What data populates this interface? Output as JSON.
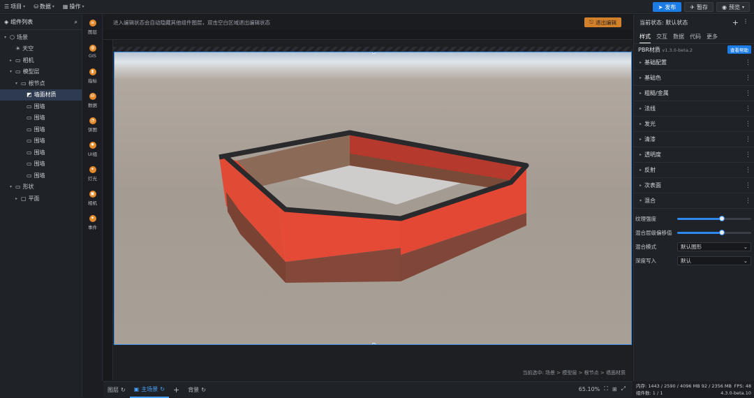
{
  "topbar": {
    "menus": [
      {
        "icon": "list-icon",
        "label": "项目"
      },
      {
        "icon": "database-icon",
        "label": "数据"
      },
      {
        "icon": "grid-icon",
        "label": "操作"
      }
    ],
    "publish_label": "发布",
    "save_label": "暂存",
    "preview_label": "预览"
  },
  "left": {
    "title": "组件列表",
    "tree": [
      {
        "label": "场景",
        "depth": 0,
        "caret": "down",
        "icon": "box-icon"
      },
      {
        "label": "天空",
        "depth": 1,
        "caret": "",
        "icon": "sun-icon"
      },
      {
        "label": "相机",
        "depth": 1,
        "caret": "right",
        "icon": "folder-icon"
      },
      {
        "label": "模型层",
        "depth": 1,
        "caret": "down",
        "icon": "folder-icon"
      },
      {
        "label": "根节点",
        "depth": 2,
        "caret": "down",
        "icon": "folder-icon"
      },
      {
        "label": "墙面材质",
        "depth": 3,
        "caret": "",
        "icon": "material-icon",
        "selected": true
      },
      {
        "label": "围墙",
        "depth": 3,
        "caret": "",
        "icon": "folder-icon"
      },
      {
        "label": "围墙",
        "depth": 3,
        "caret": "",
        "icon": "folder-icon"
      },
      {
        "label": "围墙",
        "depth": 3,
        "caret": "",
        "icon": "folder-icon"
      },
      {
        "label": "围墙",
        "depth": 3,
        "caret": "",
        "icon": "folder-icon"
      },
      {
        "label": "围墙",
        "depth": 3,
        "caret": "",
        "icon": "folder-icon"
      },
      {
        "label": "围墙",
        "depth": 3,
        "caret": "",
        "icon": "folder-icon"
      },
      {
        "label": "围墙",
        "depth": 3,
        "caret": "",
        "icon": "folder-icon"
      },
      {
        "label": "形状",
        "depth": 1,
        "caret": "down",
        "icon": "folder-icon"
      },
      {
        "label": "平面",
        "depth": 2,
        "caret": "right",
        "icon": "square-icon"
      }
    ]
  },
  "tools": [
    {
      "icon": "layers-icon",
      "label": "图层"
    },
    {
      "icon": "globe-icon",
      "label": "GIS"
    },
    {
      "icon": "chart-icon",
      "label": "指标"
    },
    {
      "icon": "database-icon",
      "label": "数据"
    },
    {
      "icon": "pie-icon",
      "label": "饼图"
    },
    {
      "icon": "gear-icon",
      "label": "UI组"
    },
    {
      "icon": "bulb-icon",
      "label": "灯光"
    },
    {
      "icon": "camera-icon",
      "label": "相机"
    },
    {
      "icon": "flame-icon",
      "label": "事件"
    }
  ],
  "canvas": {
    "hint": "进入编辑状态会自动隐藏其他组件图层，双击空白区域退出编辑状态",
    "exit_label": "退出编辑",
    "breadcrumb": "当前选中: 场景 > 模型层 > 根节点 > 墙面材质"
  },
  "bottom": {
    "tabs": [
      {
        "label": "图层",
        "active": false
      },
      {
        "label": "主场景",
        "active": true
      },
      {
        "label": "背景",
        "active": false
      }
    ],
    "add_label": "+",
    "zoom": "65.10%"
  },
  "right": {
    "state_label": "当前状态: 默认状态",
    "add_label": "+",
    "tabs": [
      "样式",
      "交互",
      "数据",
      "代码",
      "更多"
    ],
    "active_tab": 0,
    "material_name": "PBR材质",
    "material_version": "v1.3.0-beta.2",
    "view_button": "查看帮助",
    "sections": [
      {
        "label": "基础配置",
        "open": false
      },
      {
        "label": "基础色",
        "open": false
      },
      {
        "label": "粗糙/金属",
        "open": false
      },
      {
        "label": "法线",
        "open": false
      },
      {
        "label": "发光",
        "open": false
      },
      {
        "label": "清漆",
        "open": false
      },
      {
        "label": "透明度",
        "open": false
      },
      {
        "label": "反射",
        "open": false
      },
      {
        "label": "次表面",
        "open": false
      },
      {
        "label": "混合",
        "open": true
      }
    ],
    "props": [
      {
        "type": "slider",
        "label": "纹理强度",
        "value": 0.6
      },
      {
        "type": "slider",
        "label": "混合层级偏移值",
        "value": 0.6
      },
      {
        "type": "select",
        "label": "混合模式",
        "value": "默认图形"
      },
      {
        "type": "select",
        "label": "深度写入",
        "value": "默认"
      }
    ]
  },
  "status": {
    "memory": "内存: 1443 / 2590 / 4096 MB  92 / 2356 MB",
    "fps_label": "FPS:",
    "fps_value": "48",
    "count": "组件数: 1 / 1",
    "version": "4.3.0-beta.10"
  }
}
